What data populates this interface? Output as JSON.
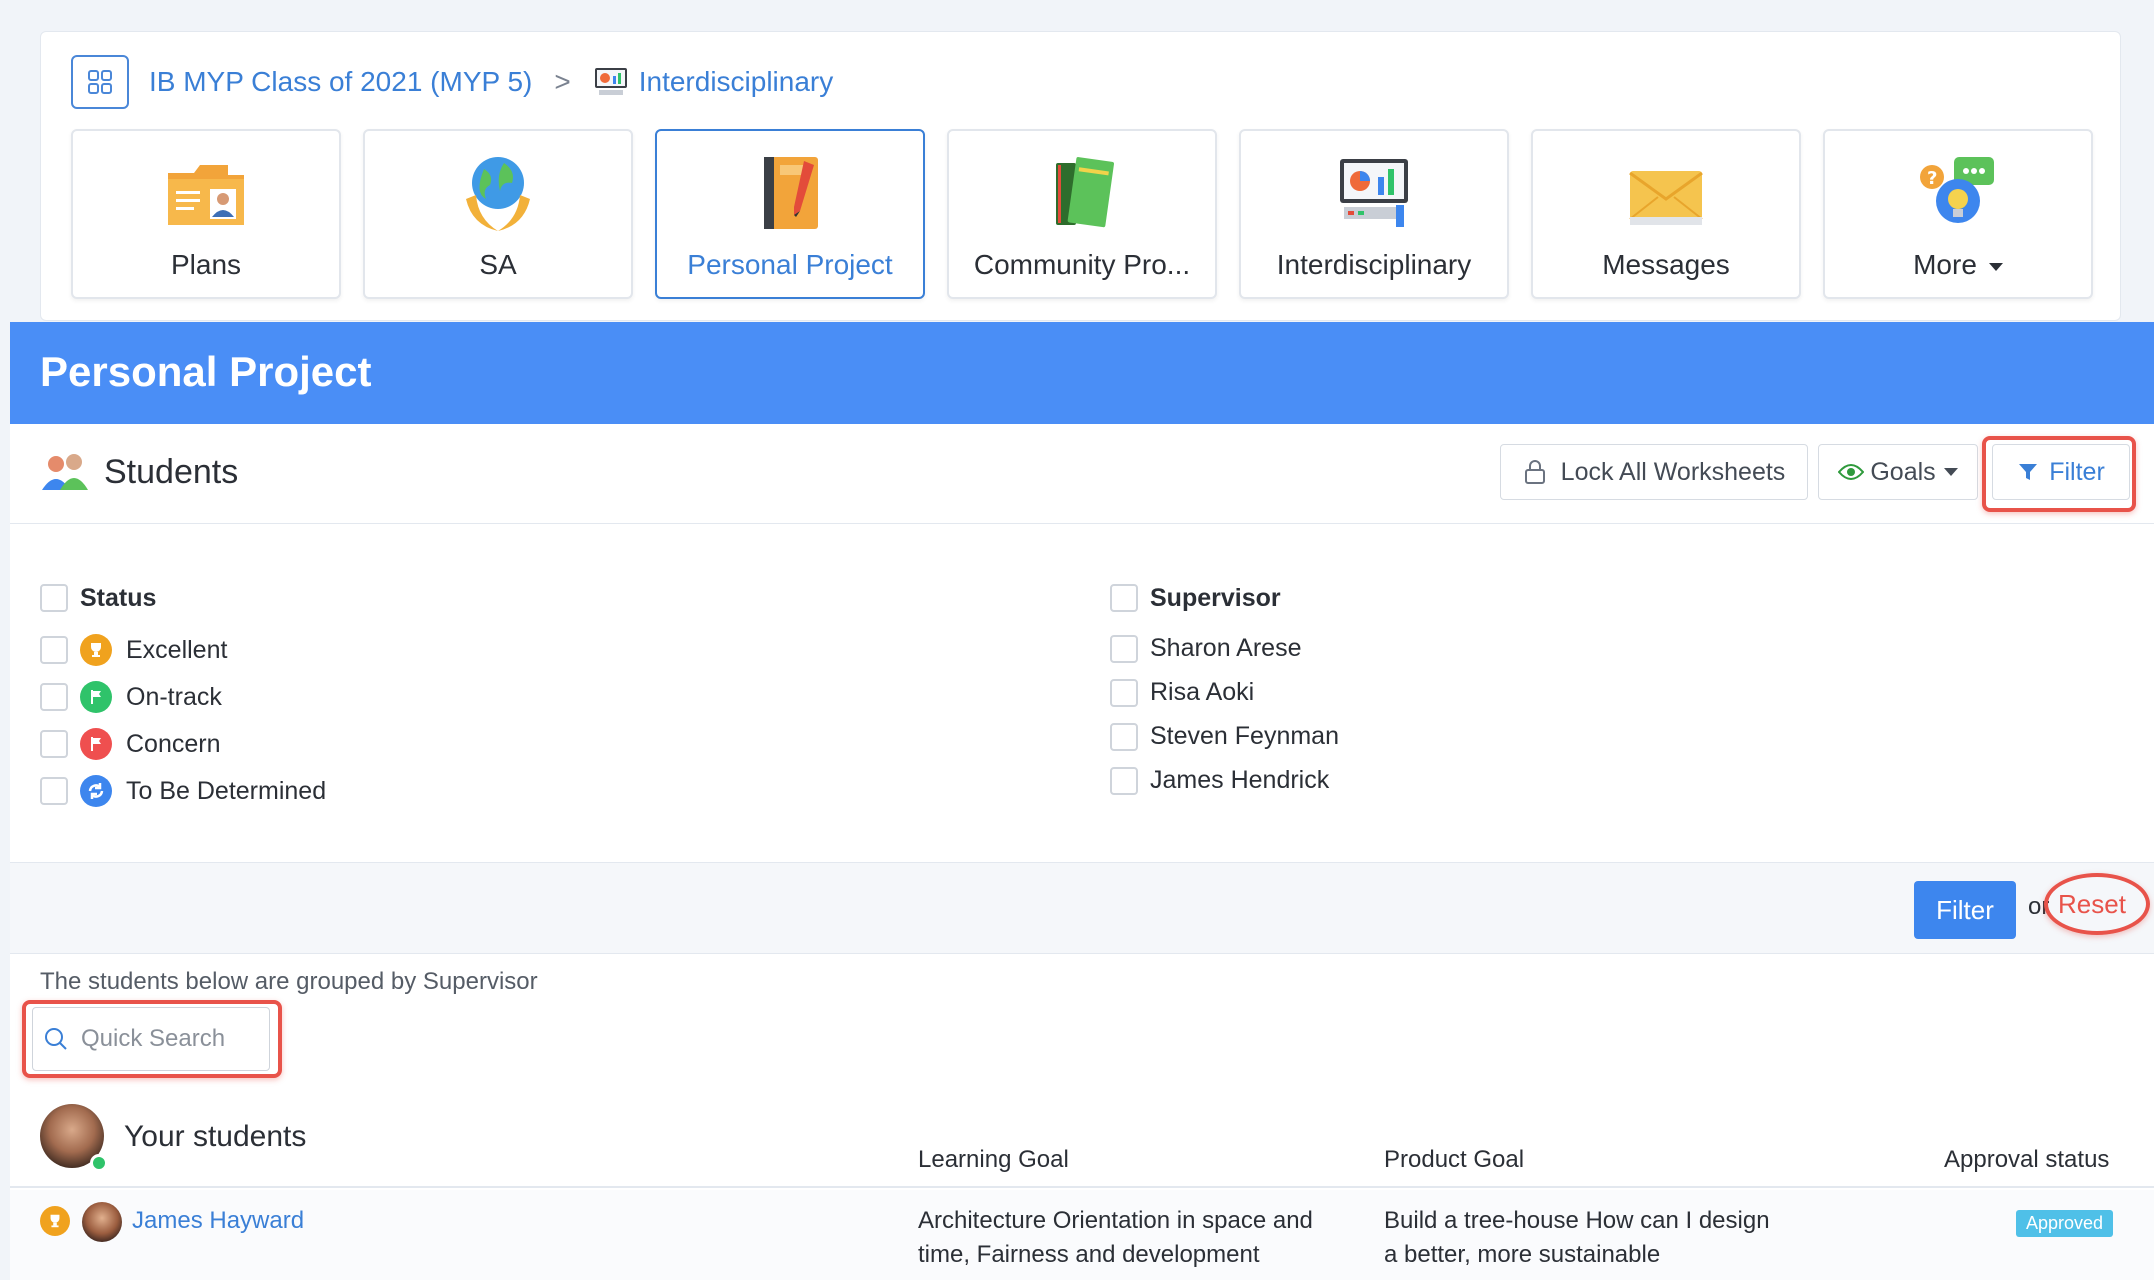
{
  "breadcrumb": {
    "class_name": "IB MYP Class of 2021 (MYP 5)",
    "separator": ">",
    "current": "Interdisciplinary"
  },
  "tiles": [
    {
      "label": "Plans",
      "icon": "folder-person-icon"
    },
    {
      "label": "SA",
      "icon": "globe-hands-icon"
    },
    {
      "label": "Personal Project",
      "icon": "notebook-pencil-icon",
      "active": true
    },
    {
      "label": "Community Pro...",
      "icon": "books-icon"
    },
    {
      "label": "Interdisciplinary",
      "icon": "presentation-board-icon"
    },
    {
      "label": "Messages",
      "icon": "envelope-icon"
    },
    {
      "label": "More",
      "icon": "chat-bulb-icon"
    }
  ],
  "page_title": "Personal Project",
  "panel": {
    "title": "Students",
    "lock_label": "Lock All Worksheets",
    "goals_label": "Goals",
    "filter_label": "Filter"
  },
  "filters": {
    "status_heading": "Status",
    "status_items": [
      {
        "label": "Excellent",
        "icon": "trophy-icon",
        "color": "#f0a21e"
      },
      {
        "label": "On-track",
        "icon": "flag-icon",
        "color": "#2fc36a"
      },
      {
        "label": "Concern",
        "icon": "flag-icon",
        "color": "#ef4f4f"
      },
      {
        "label": "To Be Determined",
        "icon": "refresh-icon",
        "color": "#3d86ee"
      }
    ],
    "supervisor_heading": "Supervisor",
    "supervisors": [
      "Sharon Arese",
      "Risa Aoki",
      "Steven Feynman",
      "James Hendrick"
    ]
  },
  "actions": {
    "apply_label": "Filter",
    "or_text": "or",
    "reset_label": "Reset"
  },
  "grouped_note": "The students below are grouped by Supervisor",
  "search": {
    "placeholder": "Quick Search",
    "value": ""
  },
  "table": {
    "group_title": "Your students",
    "columns": [
      "Learning Goal",
      "Product Goal",
      "Approval status"
    ],
    "rows": [
      {
        "name": "James Hayward",
        "learning_goal": "Architecture Orientation in space and time, Fairness and development",
        "product_goal": "Build a tree-house How can I design a better, more sustainable",
        "approval": "Approved"
      }
    ]
  },
  "colors": {
    "accent": "#3a7fd6",
    "header": "#4a8ef6",
    "highlight": "#e8534a"
  }
}
